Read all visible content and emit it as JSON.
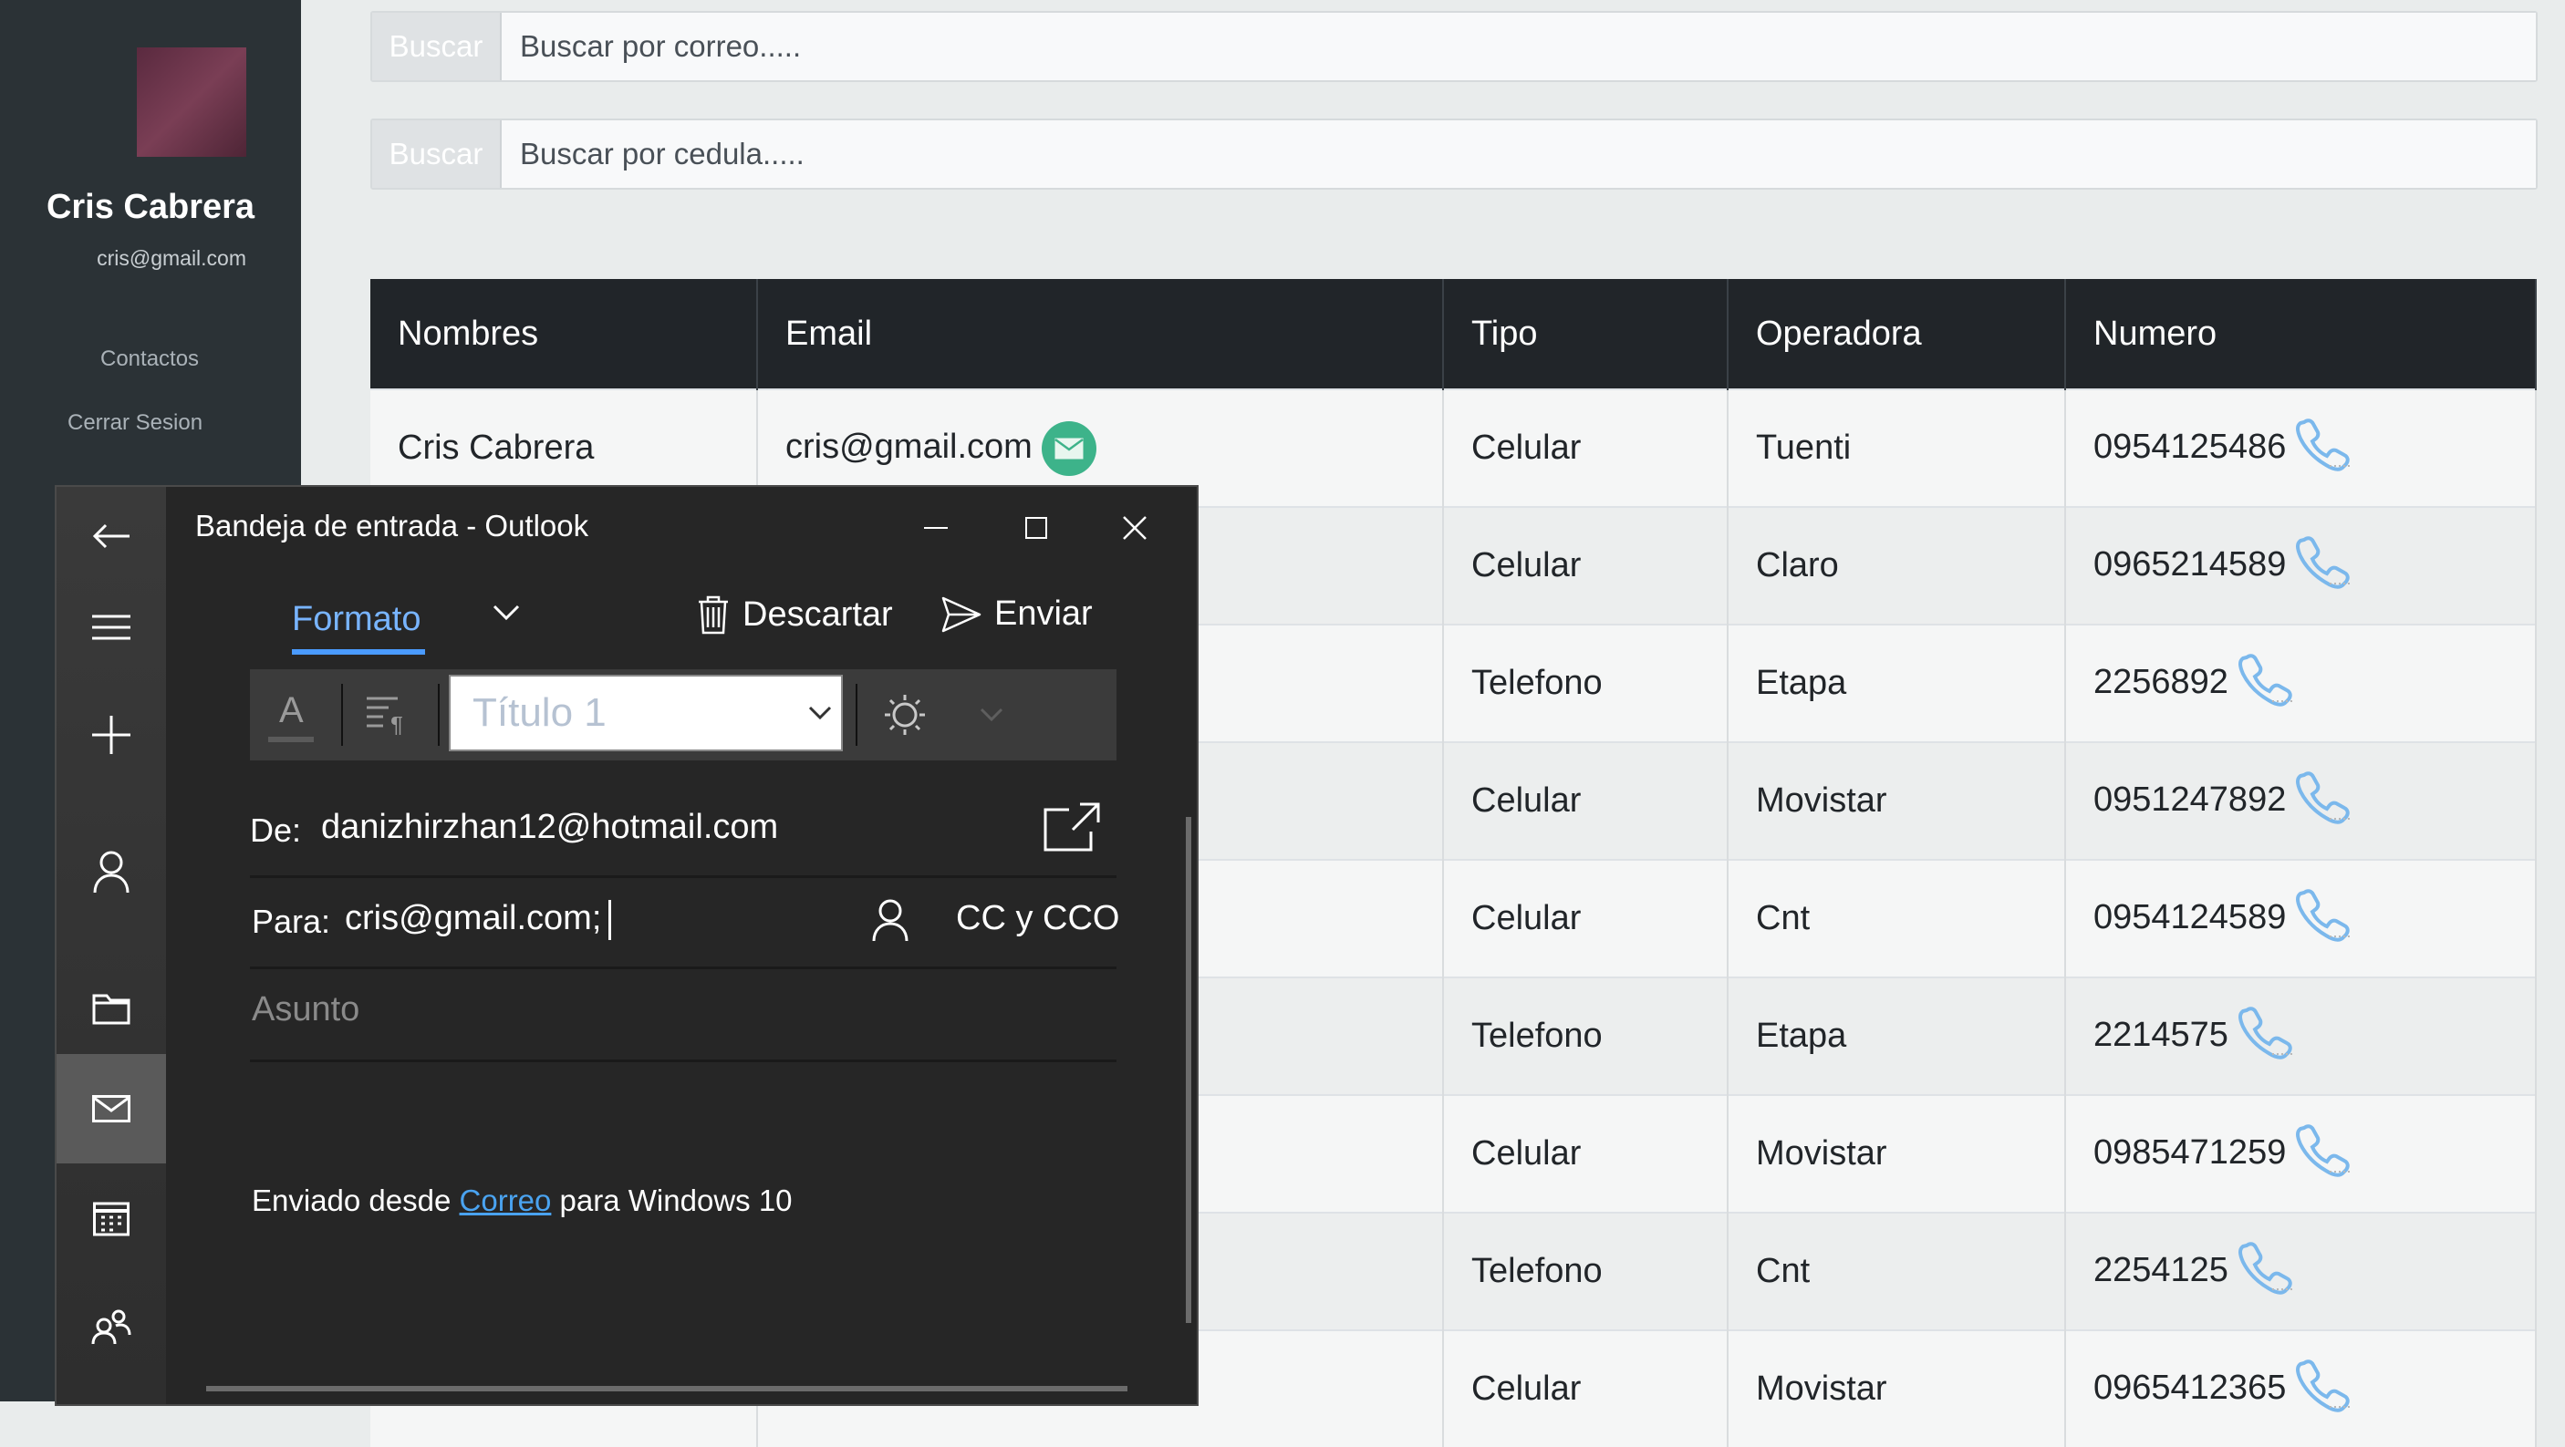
{
  "sidebar": {
    "user_name": "Cris Cabrera",
    "user_email": "cris@gmail.com",
    "links": [
      "Contactos",
      "Cerrar Sesion"
    ]
  },
  "search": {
    "email": {
      "button": "Buscar",
      "placeholder": "Buscar por correo....."
    },
    "cedula": {
      "button": "Buscar",
      "placeholder": "Buscar por cedula....."
    }
  },
  "table": {
    "headers": [
      "Nombres",
      "Email",
      "Tipo",
      "Operadora",
      "Numero"
    ],
    "rows": [
      {
        "nombre": "Cris Cabrera",
        "email": "cris@gmail.com",
        "tipo": "Celular",
        "operadora": "Tuenti",
        "numero": "0954125486"
      },
      {
        "nombre": "",
        "email": "",
        "tipo": "Celular",
        "operadora": "Claro",
        "numero": "0965214589"
      },
      {
        "nombre": "",
        "email": "",
        "tipo": "Telefono",
        "operadora": "Etapa",
        "numero": "2256892"
      },
      {
        "nombre": "",
        "email": "",
        "tipo": "Celular",
        "operadora": "Movistar",
        "numero": "0951247892"
      },
      {
        "nombre": "",
        "email": "",
        "tipo": "Celular",
        "operadora": "Cnt",
        "numero": "0954124589"
      },
      {
        "nombre": "",
        "email": "",
        "tipo": "Telefono",
        "operadora": "Etapa",
        "numero": "2214575"
      },
      {
        "nombre": "",
        "email": "",
        "tipo": "Celular",
        "operadora": "Movistar",
        "numero": "0985471259"
      },
      {
        "nombre": "",
        "email": "",
        "tipo": "Telefono",
        "operadora": "Cnt",
        "numero": "2254125"
      },
      {
        "nombre": "",
        "email": "",
        "tipo": "Celular",
        "operadora": "Movistar",
        "numero": "0965412365"
      }
    ]
  },
  "outlook": {
    "title": "Bandeja de entrada - Outlook",
    "tab": "Formato",
    "discard": "Descartar",
    "send": "Enviar",
    "style": "Título 1",
    "from_label": "De:",
    "from_value": "danizhirzhan12@hotmail.com",
    "to_label": "Para:",
    "to_value": "cris@gmail.com;",
    "cc_bcc": "CC y CCO",
    "subject_placeholder": "Asunto",
    "signature_prefix": "Enviado desde ",
    "signature_link": "Correo",
    "signature_suffix": " para Windows 10"
  },
  "colors": {
    "sidebar_bg": "#2b3236",
    "table_header": "#212529",
    "outlook_accent": "#4a9bff",
    "email_badge": "#3db38a",
    "phone_icon": "#7bb8ec"
  }
}
